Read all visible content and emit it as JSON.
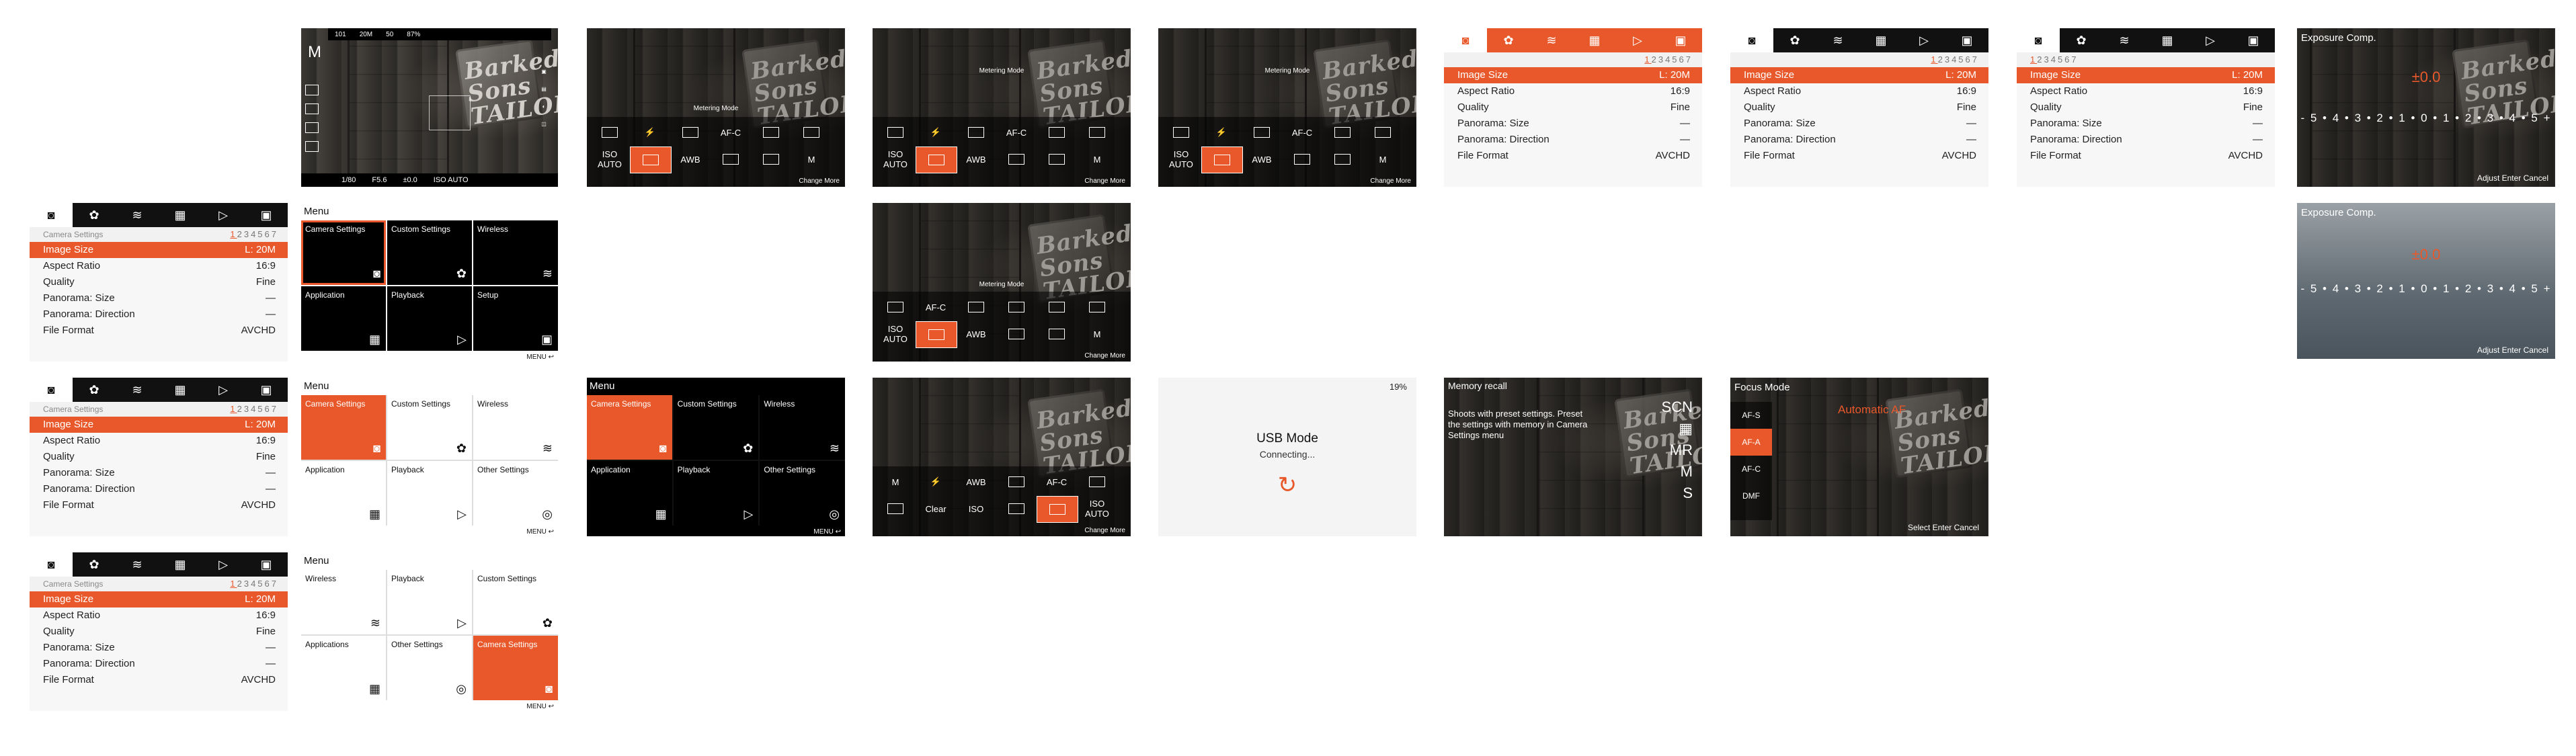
{
  "colors": {
    "accent": "#e8582a",
    "panel_dark": "#111111",
    "list_bg": "#f7f7f7"
  },
  "shooting": {
    "mode": "M",
    "top_items": [
      "101",
      "20M",
      "50",
      "87%"
    ],
    "bottom": {
      "shutter": "1/80",
      "aperture": "F5.6",
      "ev": "±0.0",
      "iso": "ISO AUTO"
    }
  },
  "fn_menu": {
    "title": "Metering Mode",
    "cells_top": [
      "",
      "⚡",
      "",
      "AF-C",
      "",
      ""
    ],
    "cells_bottom": [
      "ISO AUTO",
      "",
      "AWB",
      "",
      "",
      "M"
    ],
    "footer": "Change  More"
  },
  "fn_menu2": {
    "title": "Metering Mode",
    "cells_top": [
      "M",
      "⚡",
      "AWB",
      "",
      "AF-C",
      ""
    ],
    "cells_bottom": [
      "",
      "Clear",
      "ISO",
      "",
      "",
      "ISO AUTO"
    ],
    "footer": "Change  More"
  },
  "tabs": [
    "camera",
    "gear",
    "wireless",
    "apps",
    "play",
    "toolbox"
  ],
  "settings": {
    "section": "Camera Settings",
    "pages": [
      "1",
      "2",
      "3",
      "4",
      "5",
      "6",
      "7"
    ],
    "rows": [
      {
        "k": "Image Size",
        "v": "L: 20M"
      },
      {
        "k": "Aspect Ratio",
        "v": "16:9"
      },
      {
        "k": "Quality",
        "v": "Fine"
      },
      {
        "k": "Panorama: Size",
        "v": "—"
      },
      {
        "k": "Panorama: Direction",
        "v": "—"
      },
      {
        "k": "File Format",
        "v": "AVCHD"
      }
    ]
  },
  "menu": {
    "title": "Menu",
    "cells": [
      "Camera Settings",
      "Custom Settings",
      "Wireless",
      "Application",
      "Playback",
      "Setup"
    ],
    "cells_b": [
      "Camera Settings",
      "Custom Settings",
      "Wireless",
      "Application",
      "Playback",
      "Other Settings"
    ],
    "cells_c": [
      "Wireless",
      "Playback",
      "Custom Settings",
      "Applications",
      "Other Settings",
      "Camera Settings"
    ],
    "footer": "MENU ↩"
  },
  "exposure": {
    "title": "Exposure Comp.",
    "value": "±0.0",
    "scale": "- 5 • 4 • 3 • 2 • 1 • 0 • 1 • 2 • 3 • 4 • 5 +",
    "footer": "Adjust  Enter  Cancel"
  },
  "usb": {
    "battery": "19%",
    "title": "USB Mode",
    "sub": "Connecting...",
    "icon": "↻"
  },
  "memory_recall": {
    "title": "Memory recall",
    "text": "Shoots with preset settings. Preset the settings with memory in Camera Settings menu",
    "modes": [
      "SCN",
      "",
      "MR",
      "M",
      "S"
    ]
  },
  "focus": {
    "title": "Focus Mode",
    "items": [
      "AF-S",
      "AF-A",
      "AF-C",
      "DMF"
    ],
    "selected_name": "Automatic AF",
    "footer": "Select  Enter  Cancel"
  },
  "photo_sign": "Barked Sons TAILORS"
}
